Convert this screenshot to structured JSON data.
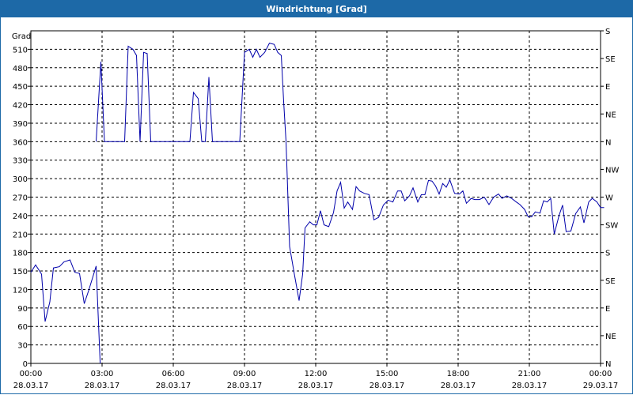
{
  "window": {
    "title": "Windrichtung [Grad]"
  },
  "colors": {
    "titlebar": "#1d69a7",
    "series": "#0000aa",
    "grid": "#000000"
  },
  "chart_data": {
    "type": "line",
    "ylabel": "Grad",
    "ylim": [
      0,
      540
    ],
    "yticks": [
      0,
      30,
      60,
      90,
      120,
      150,
      180,
      210,
      240,
      270,
      300,
      330,
      360,
      390,
      420,
      450,
      480,
      510
    ],
    "right_axis_labels": [
      {
        "value": 0,
        "label": "N"
      },
      {
        "value": 45,
        "label": "NE"
      },
      {
        "value": 90,
        "label": "E"
      },
      {
        "value": 135,
        "label": "SE"
      },
      {
        "value": 180,
        "label": "S"
      },
      {
        "value": 225,
        "label": "SW"
      },
      {
        "value": 270,
        "label": "W"
      },
      {
        "value": 315,
        "label": "NW"
      },
      {
        "value": 360,
        "label": "N"
      },
      {
        "value": 405,
        "label": "NE"
      },
      {
        "value": 450,
        "label": "E"
      },
      {
        "value": 495,
        "label": "SE"
      },
      {
        "value": 540,
        "label": "S"
      }
    ],
    "xlim": [
      0,
      24
    ],
    "xticks": [
      {
        "t": 0,
        "time": "00:00",
        "date": "28.03.17"
      },
      {
        "t": 3,
        "time": "03:00",
        "date": "28.03.17"
      },
      {
        "t": 6,
        "time": "06:00",
        "date": "28.03.17"
      },
      {
        "t": 9,
        "time": "09:00",
        "date": "28.03.17"
      },
      {
        "t": 12,
        "time": "12:00",
        "date": "28.03.17"
      },
      {
        "t": 15,
        "time": "15:00",
        "date": "28.03.17"
      },
      {
        "t": 18,
        "time": "18:00",
        "date": "28.03.17"
      },
      {
        "t": 21,
        "time": "21:00",
        "date": "28.03.17"
      },
      {
        "t": 24,
        "time": "00:00",
        "date": "29.03.17"
      }
    ],
    "grid": true,
    "segments": [
      [
        [
          0.0,
          148
        ],
        [
          0.2,
          160
        ],
        [
          0.45,
          145
        ],
        [
          0.6,
          68
        ],
        [
          0.8,
          100
        ],
        [
          0.95,
          155
        ],
        [
          1.2,
          157
        ],
        [
          1.4,
          165
        ],
        [
          1.65,
          168
        ],
        [
          1.85,
          148
        ],
        [
          2.05,
          146
        ],
        [
          2.25,
          97
        ],
        [
          2.45,
          120
        ],
        [
          2.75,
          158
        ],
        [
          2.92,
          0
        ]
      ],
      [
        [
          2.75,
          360
        ],
        [
          2.95,
          490
        ],
        [
          3.1,
          360
        ],
        [
          3.3,
          360
        ],
        [
          3.6,
          360
        ],
        [
          3.95,
          360
        ],
        [
          4.1,
          515
        ],
        [
          4.3,
          510
        ],
        [
          4.45,
          500
        ],
        [
          4.6,
          360
        ],
        [
          4.75,
          505
        ],
        [
          4.9,
          503
        ],
        [
          5.05,
          360
        ],
        [
          5.3,
          360
        ],
        [
          5.6,
          360
        ],
        [
          5.9,
          360
        ],
        [
          6.2,
          360
        ],
        [
          6.5,
          360
        ],
        [
          6.7,
          360
        ],
        [
          6.85,
          440
        ],
        [
          7.05,
          430
        ],
        [
          7.2,
          360
        ],
        [
          7.35,
          360
        ],
        [
          7.5,
          465
        ],
        [
          7.65,
          360
        ],
        [
          7.9,
          360
        ],
        [
          8.2,
          360
        ],
        [
          8.5,
          360
        ],
        [
          8.8,
          360
        ],
        [
          9.0,
          505
        ],
        [
          9.2,
          510
        ],
        [
          9.35,
          497
        ],
        [
          9.5,
          510
        ],
        [
          9.65,
          497
        ],
        [
          9.85,
          505
        ],
        [
          10.05,
          520
        ],
        [
          10.25,
          518
        ],
        [
          10.4,
          505
        ],
        [
          10.55,
          500
        ],
        [
          10.65,
          425
        ],
        [
          10.75,
          360
        ]
      ],
      [
        [
          10.75,
          360
        ],
        [
          10.9,
          190
        ],
        [
          11.1,
          145
        ],
        [
          11.3,
          102
        ],
        [
          11.45,
          145
        ],
        [
          11.55,
          220
        ],
        [
          11.75,
          230
        ],
        [
          11.9,
          225
        ],
        [
          12.05,
          225
        ],
        [
          12.2,
          248
        ],
        [
          12.35,
          225
        ],
        [
          12.55,
          222
        ],
        [
          12.75,
          245
        ],
        [
          12.9,
          280
        ],
        [
          13.05,
          294
        ],
        [
          13.2,
          252
        ],
        [
          13.35,
          262
        ],
        [
          13.55,
          250
        ],
        [
          13.7,
          287
        ],
        [
          13.85,
          280
        ],
        [
          14.05,
          276
        ],
        [
          14.25,
          274
        ],
        [
          14.45,
          233
        ],
        [
          14.65,
          237
        ],
        [
          14.85,
          257
        ],
        [
          15.05,
          265
        ],
        [
          15.25,
          262
        ],
        [
          15.45,
          280
        ],
        [
          15.6,
          280
        ],
        [
          15.75,
          264
        ],
        [
          15.95,
          272
        ],
        [
          16.1,
          285
        ],
        [
          16.3,
          262
        ],
        [
          16.45,
          274
        ],
        [
          16.6,
          274
        ],
        [
          16.75,
          297
        ],
        [
          16.9,
          296
        ],
        [
          17.05,
          288
        ],
        [
          17.2,
          275
        ],
        [
          17.35,
          292
        ],
        [
          17.5,
          286
        ],
        [
          17.65,
          298
        ],
        [
          17.85,
          276
        ],
        [
          18.05,
          275
        ],
        [
          18.2,
          280
        ],
        [
          18.35,
          260
        ],
        [
          18.55,
          268
        ],
        [
          18.7,
          266
        ],
        [
          18.9,
          266
        ],
        [
          19.1,
          270
        ],
        [
          19.3,
          258
        ],
        [
          19.5,
          270
        ],
        [
          19.7,
          275
        ],
        [
          19.85,
          268
        ],
        [
          20.05,
          272
        ],
        [
          20.25,
          268
        ],
        [
          20.45,
          262
        ],
        [
          20.6,
          258
        ],
        [
          20.8,
          250
        ],
        [
          20.95,
          238
        ],
        [
          21.1,
          238
        ],
        [
          21.25,
          246
        ],
        [
          21.45,
          244
        ],
        [
          21.6,
          264
        ],
        [
          21.75,
          262
        ],
        [
          21.9,
          268
        ],
        [
          22.05,
          210
        ],
        [
          22.25,
          240
        ],
        [
          22.4,
          257
        ],
        [
          22.55,
          214
        ],
        [
          22.75,
          215
        ],
        [
          22.95,
          243
        ],
        [
          23.15,
          254
        ],
        [
          23.3,
          228
        ],
        [
          23.5,
          262
        ],
        [
          23.65,
          268
        ],
        [
          23.85,
          262
        ],
        [
          24.0,
          253
        ],
        [
          24.15,
          253
        ]
      ]
    ]
  }
}
